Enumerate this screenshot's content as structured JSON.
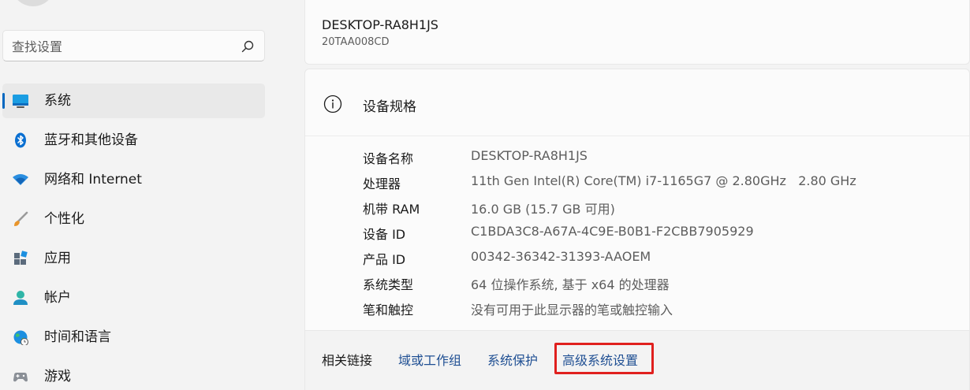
{
  "search": {
    "placeholder": "查找设置"
  },
  "sidebar": {
    "items": [
      {
        "label": "系统",
        "icon": "system-monitor-icon",
        "selected": true
      },
      {
        "label": "蓝牙和其他设备",
        "icon": "bluetooth-icon"
      },
      {
        "label": "网络和 Internet",
        "icon": "wifi-icon"
      },
      {
        "label": "个性化",
        "icon": "brush-icon"
      },
      {
        "label": "应用",
        "icon": "apps-icon"
      },
      {
        "label": "帐户",
        "icon": "account-icon"
      },
      {
        "label": "时间和语言",
        "icon": "time-language-icon"
      },
      {
        "label": "游戏",
        "icon": "gamepad-icon"
      }
    ]
  },
  "device": {
    "name": "DESKTOP-RA8H1JS",
    "model": "20TAA008CD"
  },
  "specs": {
    "title": "设备规格",
    "rows": [
      {
        "key": "设备名称",
        "value": "DESKTOP-RA8H1JS"
      },
      {
        "key": "处理器",
        "value": "11th Gen Intel(R) Core(TM) i7-1165G7 @ 2.80GHz   2.80 GHz"
      },
      {
        "key": "机带 RAM",
        "value": "16.0 GB (15.7 GB 可用)"
      },
      {
        "key": "设备 ID",
        "value": "C1BDA3C8-A67A-4C9E-B0B1-F2CBB7905929"
      },
      {
        "key": "产品 ID",
        "value": "00342-36342-31393-AAOEM"
      },
      {
        "key": "系统类型",
        "value": "64 位操作系统, 基于 x64 的处理器"
      },
      {
        "key": "笔和触控",
        "value": "没有可用于此显示器的笔或触控输入"
      }
    ]
  },
  "related": {
    "label": "相关链接",
    "links": [
      "域或工作组",
      "系统保护",
      "高级系统设置"
    ],
    "highlighted": "高级系统设置"
  },
  "colors": {
    "accent": "#0067c0",
    "link": "#1f4f93",
    "highlight_border": "#e0201e"
  }
}
